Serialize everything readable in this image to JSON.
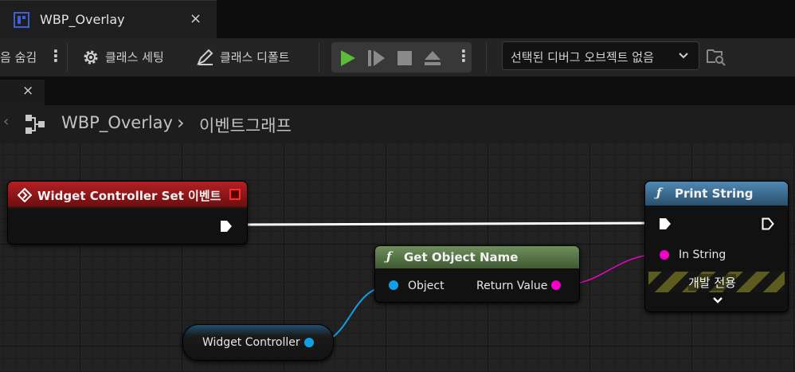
{
  "tab": {
    "title": "WBP_Overlay",
    "close": "×"
  },
  "toolbar": {
    "hide_label": "음 숨김",
    "class_settings": "클래스 세팅",
    "class_defaults": "클래스 디폴트",
    "debug_object": "선택된 디버그 오브젝트 없음"
  },
  "subtab": {
    "close": "×"
  },
  "breadcrumb": {
    "graph_name": "WBP_Overlay",
    "separator": "›",
    "page": "이벤트그래프"
  },
  "nodes": {
    "event": {
      "title": "Widget Controller Set 이벤트"
    },
    "get_object_name": {
      "title": "Get Object Name",
      "input": "Object",
      "output": "Return Value",
      "icon": "ƒ"
    },
    "print_string": {
      "title": "Print String",
      "input": "In String",
      "dev_only": "개발 전용",
      "icon": "ƒ"
    },
    "variable": {
      "label": "Widget Controller"
    }
  },
  "colors": {
    "event_header": "#a3191b",
    "function_header": "#5c7a4a",
    "print_header": "#3e6f93",
    "exec": "#ffffff",
    "object_pin": "#129fe8",
    "string_pin": "#f000c8",
    "play_green": "#5dbb3c"
  }
}
